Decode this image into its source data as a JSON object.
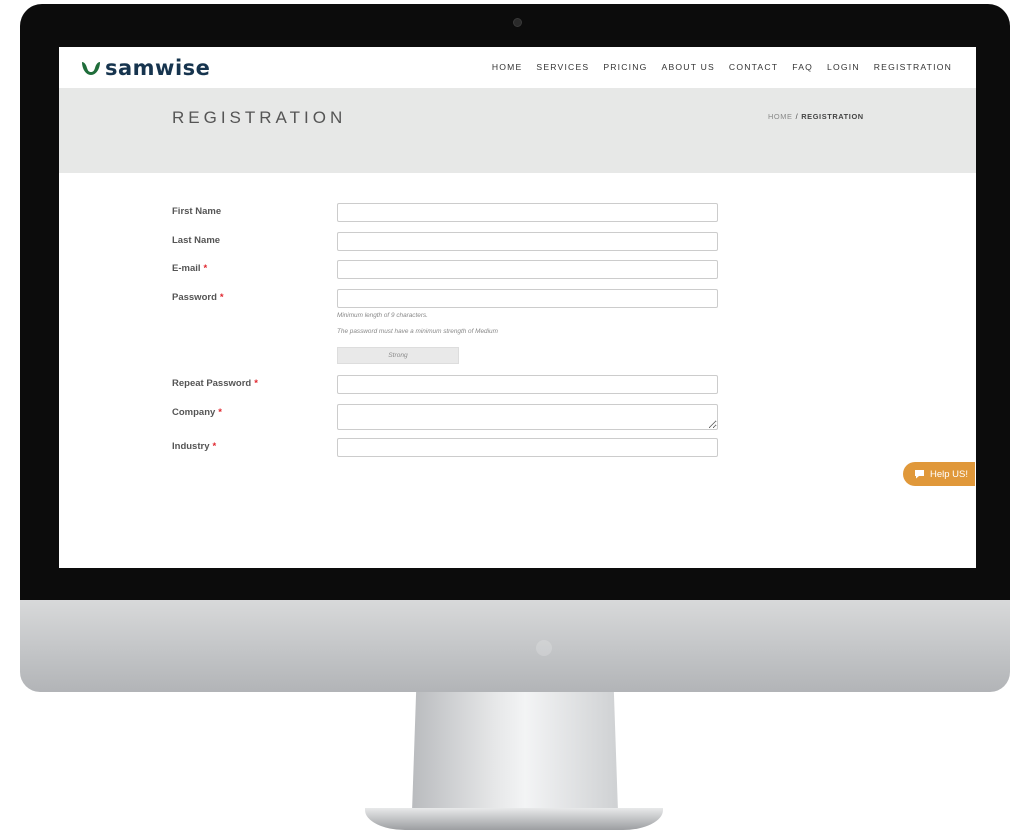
{
  "brand": {
    "name": "samwise",
    "logo_color": "#1f6d3a",
    "text_color": "#16344e"
  },
  "nav": {
    "items": [
      "HOME",
      "SERVICES",
      "PRICING",
      "ABOUT US",
      "CONTACT",
      "FAQ",
      "LOGIN",
      "REGISTRATION"
    ]
  },
  "page": {
    "title": "REGISTRATION",
    "breadcrumb": {
      "home": "HOME",
      "separator": "/",
      "current": "REGISTRATION"
    }
  },
  "form": {
    "required_marker": "*",
    "fields": [
      {
        "label": "First Name",
        "value": "",
        "required": false
      },
      {
        "label": "Last Name",
        "value": "",
        "required": false
      },
      {
        "label": "E-mail",
        "value": "",
        "required": true
      },
      {
        "label": "Password",
        "value": "",
        "required": true
      },
      {
        "label": "Repeat Password",
        "value": "",
        "required": true
      },
      {
        "label": "Company",
        "value": "",
        "required": true
      },
      {
        "label": "Industry",
        "value": "",
        "required": true
      }
    ],
    "password_hint_length": "Minimum length of 9 characters.",
    "password_hint_strength": "The password must have a minimum strength of Medium",
    "strength_label": "Strong"
  },
  "help_button": {
    "label": "Help US!",
    "color": "#e0983a",
    "icon": "speech-bubble-icon"
  }
}
